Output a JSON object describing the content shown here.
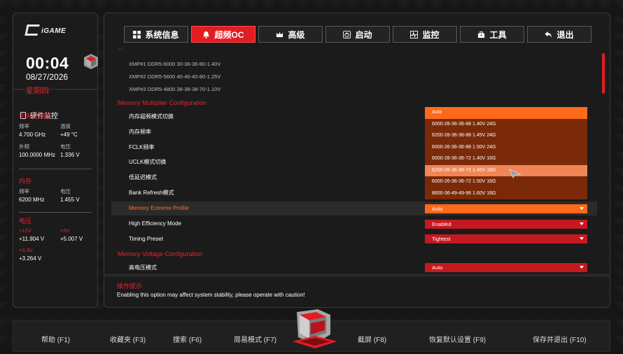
{
  "brand": {
    "logo_text": "iGAME"
  },
  "clock": {
    "time": "00:04",
    "date": "08/27/2026",
    "weekday": "星期四"
  },
  "monitor": {
    "title": "硬件监控",
    "cpu": {
      "section": "中央处理器",
      "freq_label": "频率",
      "freq": "4.700 GHz",
      "temp_label": "温度",
      "temp": "+49 °C",
      "bclk_label": "外频",
      "bclk": "100.0000 MHz",
      "volt_label": "电压",
      "volt": "1.336 V"
    },
    "mem": {
      "section": "内存",
      "freq_label": "频率",
      "freq": "6200 MHz",
      "volt_label": "电压",
      "volt": "1.455 V"
    },
    "voltage": {
      "section": "电压",
      "v12_label": "+12V",
      "v12": "+11.904 V",
      "v5_label": "+5V",
      "v5": "+5.007 V",
      "v33_label": "+3.3V",
      "v33": "+3.264 V"
    }
  },
  "tabs": [
    {
      "label": "系统信息",
      "icon": "grid-icon"
    },
    {
      "label": "超频OC",
      "icon": "bell-icon"
    },
    {
      "label": "高级",
      "icon": "crown-icon"
    },
    {
      "label": "启动",
      "icon": "power-icon"
    },
    {
      "label": "监控",
      "icon": "pulse-icon"
    },
    {
      "label": "工具",
      "icon": "toolbox-icon"
    },
    {
      "label": "退出",
      "icon": "back-arrow-icon"
    }
  ],
  "main": {
    "xmp": [
      "XMP#1  DDR5-6000 30-36-36-80-1.40V",
      "XMP#2  DDR5-5600 40-40-40-80-1.25V",
      "XMP#3  DDR5-4800 38-38-38-70-1.10V"
    ],
    "section_multiplier": "Memory Multiplier Configuration",
    "items": {
      "mem_oc_switch": "内存超频模式切换",
      "mem_freq": "内存频率",
      "fclk": "FCLK频率",
      "uclk": "UCLK模式切换",
      "low_latency": "低延迟模式",
      "bank_refresh": "Bank Refresh模式",
      "mem_extreme": "Memory Extreme Profile",
      "high_eff": "High Efficiency Mode",
      "timing": "Timing Preset"
    },
    "values": {
      "mem_extreme": "Auto",
      "high_eff": "Enabled",
      "timing": "Tightest",
      "voltage_first": "Auto"
    },
    "dropdown_options": [
      "Auto",
      "6000-28-36-36-88 1.40V 24G",
      "6200-28-36-36-88 1.45V 24G",
      "6000-26-36-36-88 1.50V 24G",
      "6000-28-36-36-72 1.40V 16G",
      "6200-28-36-36-72 1.45V 16G",
      "6000-26-36-36-72 1.50V 16G",
      "8600-36-49-49-96 1.60V 16G"
    ],
    "section_voltage": "Memory Voltage Configuration",
    "voltage_first_item": "高电压模式"
  },
  "info": {
    "title": "操作提示",
    "text": "Enabling this option may affect system stability, please operate with caution!"
  },
  "footer": [
    "帮助 (F1)",
    "收藏夹 (F3)",
    "搜索 (F6)",
    "简易模式 (F7)",
    "截屏 (F8)",
    "恢复默认设置 (F9)",
    "保存并退出 (F10)"
  ],
  "colors": {
    "accent": "#e21c23",
    "orange": "#ff6a1a",
    "dropdown_bg": "#7a2a08"
  }
}
